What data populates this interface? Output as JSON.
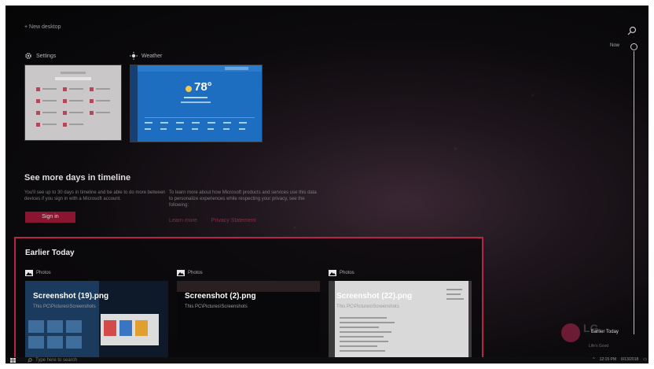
{
  "header": {
    "new_desktop": "+ New desktop"
  },
  "timeline": {
    "now_label": "Now",
    "earlier_label": "Earlier Today"
  },
  "windows": [
    {
      "app": "Settings",
      "icon": "gear-icon"
    },
    {
      "app": "Weather",
      "icon": "sun-icon",
      "temperature": "78°"
    }
  ],
  "promo": {
    "title": "See more days in timeline",
    "body_left": "You'll see up to 30 days in timeline and be able to do more between devices if you sign in with a Microsoft account.",
    "body_right": "To learn more about how Microsoft products and services use this data to personalize experiences while respecting your privacy, see the following:",
    "signin_label": "Sign in",
    "learn_more": "Learn more",
    "privacy": "Privacy Statement"
  },
  "earlier": {
    "title": "Earlier Today",
    "activities": [
      {
        "app": "Photos",
        "file": "Screenshot (19).png",
        "path": "This PC\\Pictures\\Screenshots"
      },
      {
        "app": "Photos",
        "file": "Screenshot (2).png",
        "path": "This PC\\Pictures\\Screenshots"
      },
      {
        "app": "Photos",
        "file": "Screenshot (22).png",
        "path": "This PC\\Pictures\\Screenshots"
      }
    ]
  },
  "taskbar": {
    "search_placeholder": "Type here to search",
    "time": "12:15 PM",
    "date": "6/13/2018"
  },
  "watermark": {
    "brand": "LG",
    "tagline": "Life's Good"
  },
  "colors": {
    "accent": "#8a1531",
    "highlight_border": "#b7244a",
    "weather_blue": "#1d6ec0"
  }
}
